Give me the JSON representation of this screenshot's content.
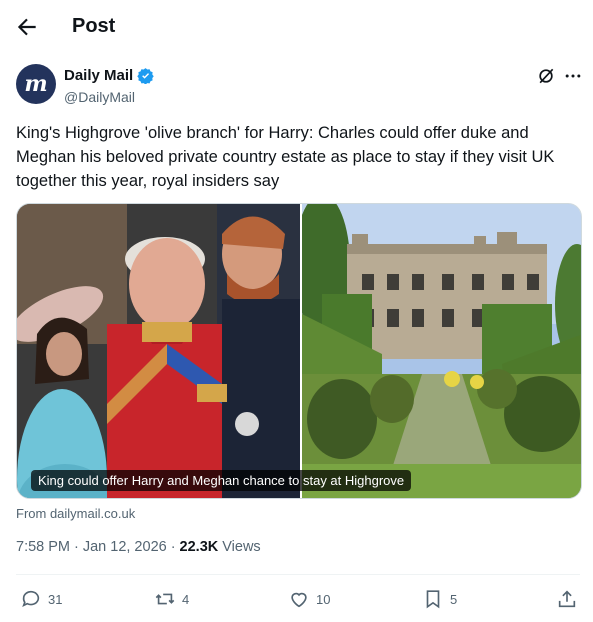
{
  "header": {
    "title": "Post"
  },
  "author": {
    "name": "Daily Mail",
    "handle": "@DailyMail",
    "avatar_letter": "m"
  },
  "tweet": {
    "text": "King's Highgrove 'olive branch' for Harry: Charles could offer duke and Meghan his beloved private country estate as place to stay if they visit UK together this year, royal insiders say",
    "media_caption": "King could offer Harry and Meghan chance to stay at Highgrove",
    "source": "From dailymail.co.uk",
    "time": "7:58 PM",
    "date": "Jan 12, 2026",
    "separator": "·",
    "views_count": "22.3K",
    "views_label": "Views"
  },
  "actions": {
    "replies": "31",
    "reposts": "4",
    "likes": "10",
    "bookmarks": "5"
  },
  "colors": {
    "text": "#0f1419",
    "secondary": "#536471",
    "verified": "#1d9bf0",
    "avatar_bg": "#23335c"
  },
  "icons": [
    "back-arrow-icon",
    "verified-icon",
    "grok-icon",
    "more-icon",
    "reply-icon",
    "repost-icon",
    "like-icon",
    "bookmark-icon",
    "share-icon"
  ]
}
